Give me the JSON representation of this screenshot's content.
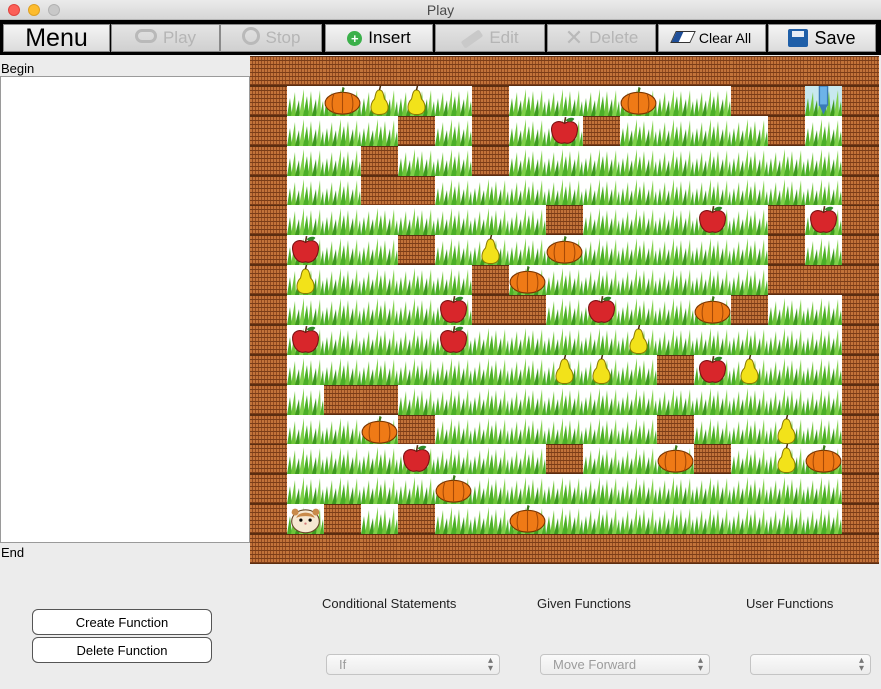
{
  "window": {
    "title": "Play"
  },
  "toolbar": {
    "menu": "Menu",
    "play": "Play",
    "stop": "Stop",
    "insert": "Insert",
    "edit": "Edit",
    "delete": "Delete",
    "clear_all": "Clear All",
    "save": "Save"
  },
  "code": {
    "begin": "Begin",
    "end": "End"
  },
  "board": {
    "rows": [
      "WWWWWWWWWWWWWWWWW",
      "WGOPPGWGGGOGGWWGW",
      "WGGGWGWGAWGGGGWGW",
      "WGGWGGWGGGGGGGGGW",
      "WGGWWGGGGGGGGGGGW",
      "WGGGGGGGWGGGAGWAW",
      "WAGGWGPGOGGGGGWGW",
      "WPGGGGWOGGGGGGWWW",
      "WGGGGAWWGAGGOWGGW",
      "WAGGGAGGGGPGGGGGW",
      "WGGGGGGGPPGWAPGGW",
      "WGWWGGGGGGGGGGGGW",
      "WGGOWGGGGGGWGGPGW",
      "WGGGAGGGWGGOWGPOW",
      "WGGGGOGGGGGGGGGGW",
      "WHWGWGGOGGGGGGGGW",
      "WWWWWWWWWWWWWWWWW"
    ],
    "legend": {
      "W": "wall",
      "G": "grass",
      "A": "apple",
      "P": "pear",
      "O": "pumpkin",
      "H": "hamster",
      "X": "goal-flag"
    },
    "goal": {
      "row": 1,
      "col": 15
    }
  },
  "functions": {
    "create": "Create Function",
    "delete": "Delete Function"
  },
  "sections": {
    "conditional": {
      "label": "Conditional Statements",
      "selected": "If"
    },
    "given": {
      "label": "Given Functions",
      "selected": "Move Forward"
    },
    "user": {
      "label": "User Functions",
      "selected": ""
    }
  }
}
